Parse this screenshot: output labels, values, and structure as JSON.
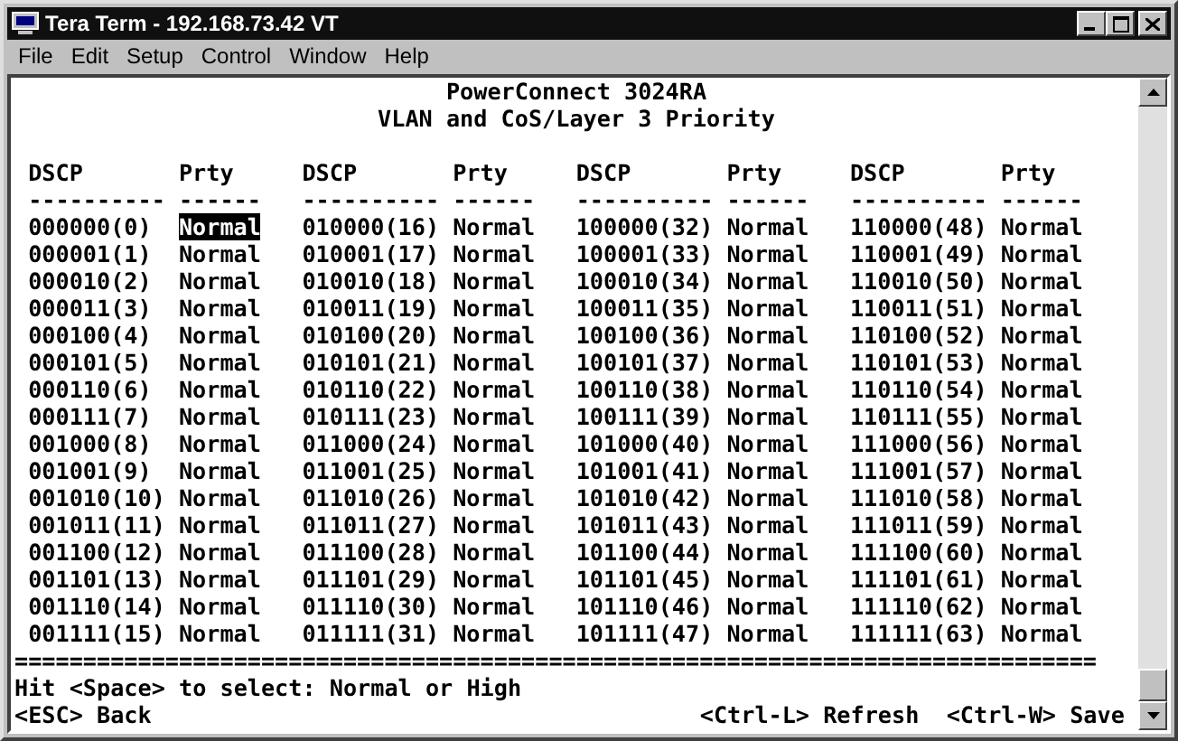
{
  "window": {
    "title": "Tera Term - 192.168.73.42 VT"
  },
  "menu": [
    {
      "label": "File"
    },
    {
      "label": "Edit"
    },
    {
      "label": "Setup"
    },
    {
      "label": "Control"
    },
    {
      "label": "Window"
    },
    {
      "label": "Help"
    }
  ],
  "terminal": {
    "heading": [
      "PowerConnect 3024RA",
      "VLAN and CoS/Layer 3 Priority"
    ],
    "groups": [
      {
        "dscp_header": "DSCP",
        "prty_header": "Prty",
        "dscp_rule": "----------",
        "prty_rule": "------",
        "entries": [
          {
            "dscp": "000000(0)",
            "prty": "Normal",
            "selected": true
          },
          {
            "dscp": "000001(1)",
            "prty": "Normal",
            "selected": false
          },
          {
            "dscp": "000010(2)",
            "prty": "Normal",
            "selected": false
          },
          {
            "dscp": "000011(3)",
            "prty": "Normal",
            "selected": false
          },
          {
            "dscp": "000100(4)",
            "prty": "Normal",
            "selected": false
          },
          {
            "dscp": "000101(5)",
            "prty": "Normal",
            "selected": false
          },
          {
            "dscp": "000110(6)",
            "prty": "Normal",
            "selected": false
          },
          {
            "dscp": "000111(7)",
            "prty": "Normal",
            "selected": false
          },
          {
            "dscp": "001000(8)",
            "prty": "Normal",
            "selected": false
          },
          {
            "dscp": "001001(9)",
            "prty": "Normal",
            "selected": false
          },
          {
            "dscp": "001010(10)",
            "prty": "Normal",
            "selected": false
          },
          {
            "dscp": "001011(11)",
            "prty": "Normal",
            "selected": false
          },
          {
            "dscp": "001100(12)",
            "prty": "Normal",
            "selected": false
          },
          {
            "dscp": "001101(13)",
            "prty": "Normal",
            "selected": false
          },
          {
            "dscp": "001110(14)",
            "prty": "Normal",
            "selected": false
          },
          {
            "dscp": "001111(15)",
            "prty": "Normal",
            "selected": false
          }
        ]
      },
      {
        "dscp_header": "DSCP",
        "prty_header": "Prty",
        "dscp_rule": "----------",
        "prty_rule": "------",
        "entries": [
          {
            "dscp": "010000(16)",
            "prty": "Normal",
            "selected": false
          },
          {
            "dscp": "010001(17)",
            "prty": "Normal",
            "selected": false
          },
          {
            "dscp": "010010(18)",
            "prty": "Normal",
            "selected": false
          },
          {
            "dscp": "010011(19)",
            "prty": "Normal",
            "selected": false
          },
          {
            "dscp": "010100(20)",
            "prty": "Normal",
            "selected": false
          },
          {
            "dscp": "010101(21)",
            "prty": "Normal",
            "selected": false
          },
          {
            "dscp": "010110(22)",
            "prty": "Normal",
            "selected": false
          },
          {
            "dscp": "010111(23)",
            "prty": "Normal",
            "selected": false
          },
          {
            "dscp": "011000(24)",
            "prty": "Normal",
            "selected": false
          },
          {
            "dscp": "011001(25)",
            "prty": "Normal",
            "selected": false
          },
          {
            "dscp": "011010(26)",
            "prty": "Normal",
            "selected": false
          },
          {
            "dscp": "011011(27)",
            "prty": "Normal",
            "selected": false
          },
          {
            "dscp": "011100(28)",
            "prty": "Normal",
            "selected": false
          },
          {
            "dscp": "011101(29)",
            "prty": "Normal",
            "selected": false
          },
          {
            "dscp": "011110(30)",
            "prty": "Normal",
            "selected": false
          },
          {
            "dscp": "011111(31)",
            "prty": "Normal",
            "selected": false
          }
        ]
      },
      {
        "dscp_header": "DSCP",
        "prty_header": "Prty",
        "dscp_rule": "----------",
        "prty_rule": "------",
        "entries": [
          {
            "dscp": "100000(32)",
            "prty": "Normal",
            "selected": false
          },
          {
            "dscp": "100001(33)",
            "prty": "Normal",
            "selected": false
          },
          {
            "dscp": "100010(34)",
            "prty": "Normal",
            "selected": false
          },
          {
            "dscp": "100011(35)",
            "prty": "Normal",
            "selected": false
          },
          {
            "dscp": "100100(36)",
            "prty": "Normal",
            "selected": false
          },
          {
            "dscp": "100101(37)",
            "prty": "Normal",
            "selected": false
          },
          {
            "dscp": "100110(38)",
            "prty": "Normal",
            "selected": false
          },
          {
            "dscp": "100111(39)",
            "prty": "Normal",
            "selected": false
          },
          {
            "dscp": "101000(40)",
            "prty": "Normal",
            "selected": false
          },
          {
            "dscp": "101001(41)",
            "prty": "Normal",
            "selected": false
          },
          {
            "dscp": "101010(42)",
            "prty": "Normal",
            "selected": false
          },
          {
            "dscp": "101011(43)",
            "prty": "Normal",
            "selected": false
          },
          {
            "dscp": "101100(44)",
            "prty": "Normal",
            "selected": false
          },
          {
            "dscp": "101101(45)",
            "prty": "Normal",
            "selected": false
          },
          {
            "dscp": "101110(46)",
            "prty": "Normal",
            "selected": false
          },
          {
            "dscp": "101111(47)",
            "prty": "Normal",
            "selected": false
          }
        ]
      },
      {
        "dscp_header": "DSCP",
        "prty_header": "Prty",
        "dscp_rule": "----------",
        "prty_rule": "------",
        "entries": [
          {
            "dscp": "110000(48)",
            "prty": "Normal",
            "selected": false
          },
          {
            "dscp": "110001(49)",
            "prty": "Normal",
            "selected": false
          },
          {
            "dscp": "110010(50)",
            "prty": "Normal",
            "selected": false
          },
          {
            "dscp": "110011(51)",
            "prty": "Normal",
            "selected": false
          },
          {
            "dscp": "110100(52)",
            "prty": "Normal",
            "selected": false
          },
          {
            "dscp": "110101(53)",
            "prty": "Normal",
            "selected": false
          },
          {
            "dscp": "110110(54)",
            "prty": "Normal",
            "selected": false
          },
          {
            "dscp": "110111(55)",
            "prty": "Normal",
            "selected": false
          },
          {
            "dscp": "111000(56)",
            "prty": "Normal",
            "selected": false
          },
          {
            "dscp": "111001(57)",
            "prty": "Normal",
            "selected": false
          },
          {
            "dscp": "111010(58)",
            "prty": "Normal",
            "selected": false
          },
          {
            "dscp": "111011(59)",
            "prty": "Normal",
            "selected": false
          },
          {
            "dscp": "111100(60)",
            "prty": "Normal",
            "selected": false
          },
          {
            "dscp": "111101(61)",
            "prty": "Normal",
            "selected": false
          },
          {
            "dscp": "111110(62)",
            "prty": "Normal",
            "selected": false
          },
          {
            "dscp": "111111(63)",
            "prty": "Normal",
            "selected": false
          }
        ]
      }
    ],
    "separator": "===============================================================================",
    "hint": "Hit <Space> to select: Normal or High",
    "back": "<ESC> Back",
    "shortcuts": [
      "<Ctrl-L> Refresh",
      "<Ctrl-W> Save"
    ]
  }
}
